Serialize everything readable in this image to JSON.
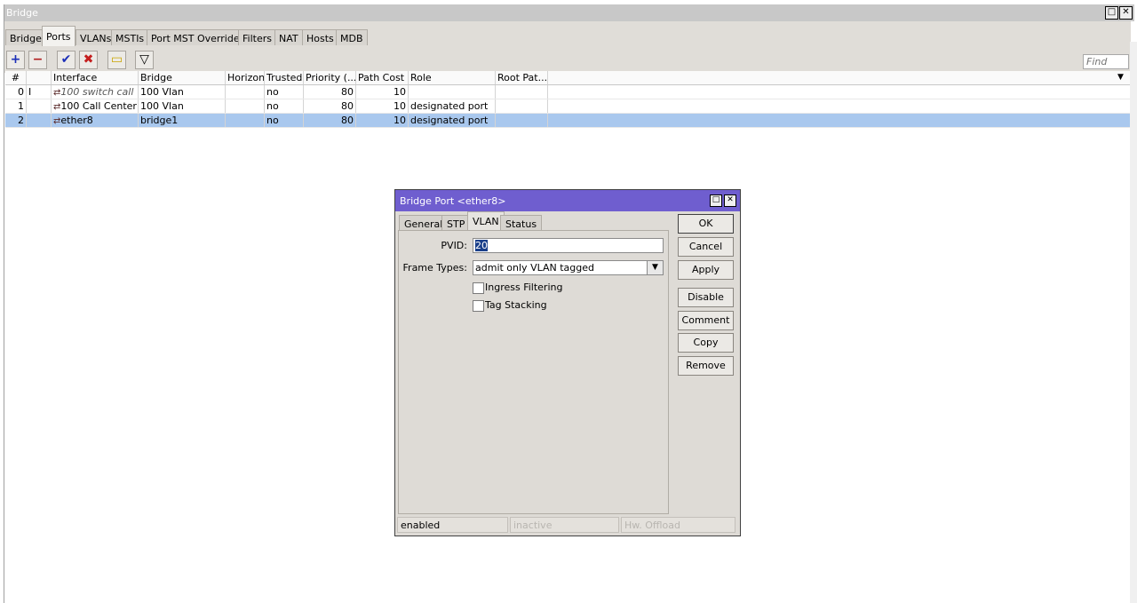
{
  "window": {
    "title": "Bridge"
  },
  "tabs": [
    "Bridge",
    "Ports",
    "VLANs",
    "MSTIs",
    "Port MST Overrides",
    "Filters",
    "NAT",
    "Hosts",
    "MDB"
  ],
  "active_tab": "Ports",
  "toolbar": {
    "add_glyph": "+",
    "remove_glyph": "−",
    "enable_glyph": "✔",
    "disable_glyph": "✖",
    "comment_glyph": "▭",
    "filter_glyph": "▽",
    "find_placeholder": "Find"
  },
  "table": {
    "columns": [
      "#",
      "",
      "Interface",
      "Bridge",
      "Horizon",
      "Trusted",
      "Priority (...",
      "Path Cost",
      "Role",
      "Root Pat..."
    ],
    "rows": [
      {
        "num": "0",
        "flag": "I",
        "interface": "100 switch call",
        "bridge": "100 Vlan",
        "horizon": "",
        "trusted": "no",
        "priority": "80",
        "path_cost": "10",
        "role": "",
        "root_path": ""
      },
      {
        "num": "1",
        "flag": "",
        "interface": "100 Call Center",
        "bridge": "100 Vlan",
        "horizon": "",
        "trusted": "no",
        "priority": "80",
        "path_cost": "10",
        "role": "designated port",
        "root_path": ""
      },
      {
        "num": "2",
        "flag": "",
        "interface": "ether8",
        "bridge": "bridge1",
        "horizon": "",
        "trusted": "no",
        "priority": "80",
        "path_cost": "10",
        "role": "designated port",
        "root_path": ""
      }
    ]
  },
  "dialog": {
    "title": "Bridge Port <ether8>",
    "tabs": [
      "General",
      "STP",
      "VLAN",
      "Status"
    ],
    "active_tab": "VLAN",
    "pvid_label": "PVID:",
    "pvid_value": "20",
    "frame_types_label": "Frame Types:",
    "frame_types_value": "admit only VLAN tagged",
    "ingress_filtering_label": "Ingress Filtering",
    "tag_stacking_label": "Tag Stacking",
    "buttons": {
      "ok": "OK",
      "cancel": "Cancel",
      "apply": "Apply",
      "disable": "Disable",
      "comment": "Comment",
      "copy": "Copy",
      "remove": "Remove"
    },
    "status": [
      "enabled",
      "inactive",
      "Hw. Offload"
    ]
  },
  "colors": {
    "dialog_title_bg": "#6f5ecf",
    "selected_row": "#a9c8ee",
    "add_icon": "#1c2fb8",
    "remove_icon": "#b01c1c"
  }
}
